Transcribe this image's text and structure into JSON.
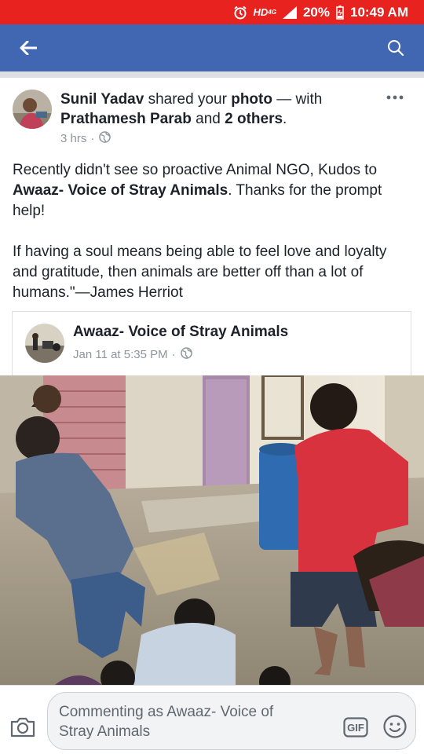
{
  "status_bar": {
    "network": "HD",
    "network_gen": "4G",
    "battery": "20%",
    "time": "10:49 AM"
  },
  "app_bar": {
    "back_icon": "back-arrow-icon",
    "search_icon": "search-icon",
    "color": "#4267b2"
  },
  "post": {
    "author": "Sunil Yadav",
    "action": " shared your ",
    "object": "photo",
    "with_text": " — with ",
    "tagged": "Prathamesh Parab",
    "and_text": " and ",
    "others": "2 others",
    "period": ".",
    "time": "3 hrs",
    "separator": "·",
    "text": {
      "line1_prefix": "Recently didn't see so proactive Animal NGO, Kudos to ",
      "page_name": "Awaaz- Voice of Stray Animals",
      "line1_suffix": ". Thanks for the prompt help!",
      "quote": " If having a soul means being able to feel love and loyalty and gratitude, then animals are better off than a lot of humans.\"—James Herriot"
    }
  },
  "shared_post": {
    "page_name": "Awaaz- Voice of Stray Animals",
    "date": "Jan 11 at 5:35 PM",
    "separator": "·"
  },
  "comment_bar": {
    "placeholder": "Commenting as Awaaz- Voice of Stray Animals",
    "gif_label": "GIF"
  },
  "colors": {
    "status_bar": "#e8231f",
    "app_bar": "#4267b2",
    "meta_text": "#90949c"
  }
}
